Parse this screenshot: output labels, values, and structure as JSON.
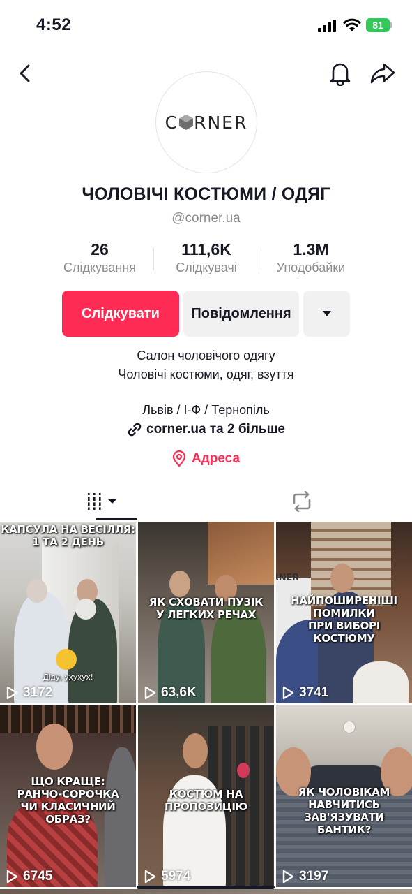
{
  "status_bar": {
    "time": "4:52",
    "battery": "81"
  },
  "profile": {
    "avatar_logo": "C⬢RNER",
    "name": "ЧОЛОВІЧІ КОСТЮМИ / ОДЯГ",
    "handle": "@corner.ua",
    "stats": [
      {
        "value": "26",
        "label": "Слідкування"
      },
      {
        "value": "111,6K",
        "label": "Слідкувачі"
      },
      {
        "value": "1.3M",
        "label": "Уподобайки"
      }
    ],
    "follow_label": "Слідкувати",
    "message_label": "Повідомлення",
    "bio_line1": "Салон чоловічого одягу",
    "bio_line2": "Чоловічі костюми, одяг, взуття",
    "bio_line3": "Львів / І-Ф / Тернопіль",
    "link_text": "corner.ua та 2 більше",
    "address_label": "Адреса"
  },
  "tabs": [
    {
      "icon": "grid-icon"
    },
    {
      "icon": "repost-icon"
    }
  ],
  "videos": [
    {
      "caption": "КАПСУЛА НА ВЕСІЛЛЯ:\n1 ТА 2 ДЕНЬ",
      "views": "3172",
      "sticker": "Діду, ухухух!"
    },
    {
      "caption": "ЯК СХОВАТИ ПУЗІК\nУ ЛЕГКИХ РЕЧАХ",
      "views": "63,6K"
    },
    {
      "caption": "НАЙПОШИРЕНІШІ ПОМИЛКИ\nПРИ ВИБОРІ КОСТЮМУ",
      "views": "3741",
      "sign": "RNER"
    },
    {
      "caption": "ЩО КРАЩЕ:\nРАНЧО-СОРОЧКА\nЧИ КЛАСИЧНИЙ ОБРАЗ?",
      "views": "6745"
    },
    {
      "caption": "КОСТЮМ НА ПРОПОЗИЦІЮ",
      "views": "5974"
    },
    {
      "caption": "ЯК ЧОЛОВІКАМ НАВЧИТИСЬ\nЗАВ'ЯЗУВАТИ БАНТИК?",
      "views": "3197"
    }
  ],
  "colors": {
    "accent": "#fe2c55",
    "text": "#161823",
    "secondary": "#8a8b91"
  }
}
